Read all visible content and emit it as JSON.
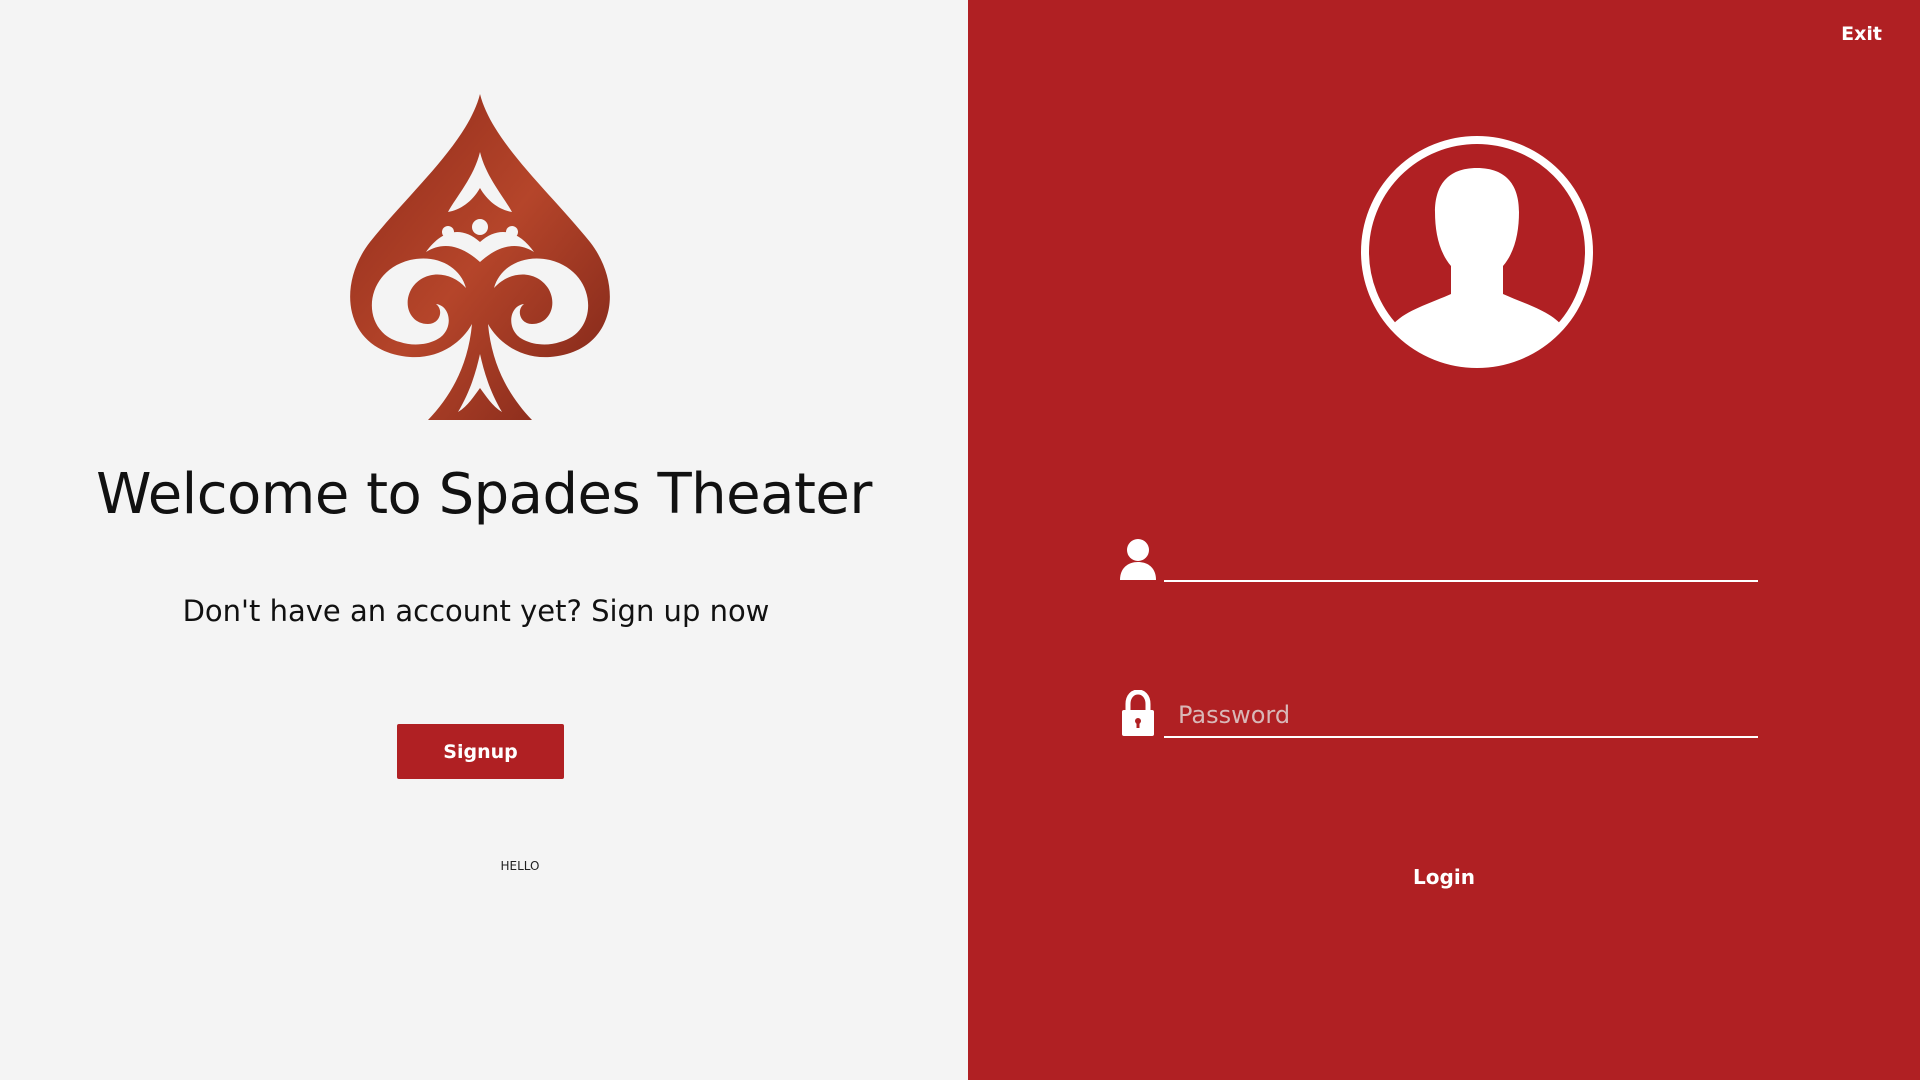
{
  "left": {
    "welcome_title": "Welcome to Spades Theater",
    "signup_prompt": "Don't have an account yet? Sign up now",
    "signup_label": "Signup",
    "hello_text": "HELLO",
    "logo_icon": "spade-logo-icon"
  },
  "right": {
    "exit_label": "Exit",
    "avatar_icon": "user-avatar-icon",
    "username": {
      "value": "",
      "placeholder": "",
      "icon": "user-icon"
    },
    "password": {
      "value": "",
      "placeholder": "Password",
      "icon": "lock-icon"
    },
    "login_label": "Login"
  },
  "colors": {
    "brand_red": "#b02023",
    "left_background": "#f4f4f4",
    "logo_red": "#a33a24"
  }
}
